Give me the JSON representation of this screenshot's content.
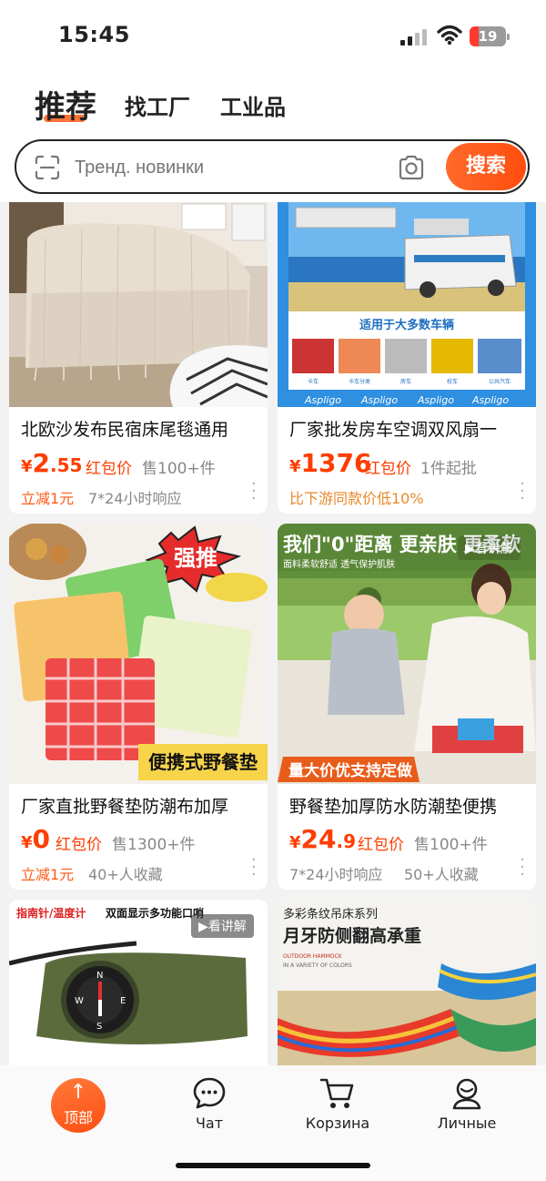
{
  "status": {
    "time": "15:45",
    "battery": "19"
  },
  "header": {
    "tabs": [
      {
        "label": "推荐"
      },
      {
        "label": "找工厂"
      },
      {
        "label": "工业品"
      }
    ]
  },
  "search": {
    "placeholder": "Тренд. новинки",
    "button": "搜索"
  },
  "products": [
    {
      "title": "北欧沙发布民宿床尾毯通用",
      "cur": "¥",
      "price_int": "2",
      "price_dec": ".55",
      "red_pack": "红包价",
      "sold": "售100+件",
      "tag1": "立减1元",
      "tag2": "7*24小时响应"
    },
    {
      "title": "厂家批发房车空调双风扇一",
      "cur": "¥",
      "price_int": "1376",
      "price_dec": "",
      "red_pack": "红包价",
      "sold": "1件起批",
      "tag1": "比下游同款价低10%",
      "tag2": "",
      "image_text": {
        "brand": "Aspligo",
        "caption": "适用于大多数车辆",
        "thumbs": [
          "卡车",
          "卡车分类",
          "房车",
          "校车",
          "公共汽车"
        ]
      }
    },
    {
      "title": "厂家直批野餐垫防潮布加厚",
      "cur": "¥",
      "price_int": "0",
      "price_dec": "",
      "red_pack": "红包价",
      "sold": "售1300+件",
      "tag1": "立减1元",
      "tag2": "40+人收藏",
      "image_text": {
        "badge": "强推",
        "banner": "便携式野餐垫"
      }
    },
    {
      "title": "野餐垫加厚防水防潮垫便携",
      "cur": "¥",
      "price_int": "24",
      "price_dec": ".9",
      "red_pack": "红包价",
      "sold": "售100+件",
      "tag1": "7*24小时响应",
      "tag2": "50+人收藏",
      "image_text": {
        "headline": "我们\"0\"距离 更亲肤 更柔软",
        "sub": "面料柔软舒适 透气保护肌肤",
        "banner": "量大价优支持定做",
        "watch": "▶看讲解"
      }
    },
    {
      "title": "",
      "image_text": {
        "headline_red": "指南针/温度计",
        "headline_black": "双面显示多功能口哨",
        "watch": "▶看讲解"
      }
    },
    {
      "title": "",
      "image_text": {
        "line1": "多彩条纹吊床系列",
        "line2": "月牙防侧翻高承重",
        "line3": "OUTDOOR HAMMOCK",
        "line4": "IN A VARIETY OF COLORS"
      }
    }
  ],
  "bottom_nav": {
    "top_button": {
      "arrow": "↑",
      "label": "顶部"
    },
    "items": [
      {
        "label": "Чат"
      },
      {
        "label": "Корзина"
      },
      {
        "label": "Личные"
      }
    ]
  },
  "colors": {
    "accent": "#ff5a14",
    "price": "#ff3d00"
  }
}
